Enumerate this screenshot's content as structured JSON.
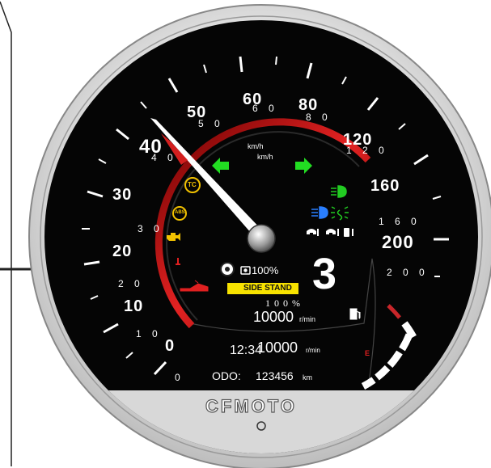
{
  "brand": {
    "name": "CFMOTO"
  },
  "speedometer": {
    "unit": "km/h",
    "major_scale": [
      "0",
      "10",
      "20",
      "30",
      "40",
      "50",
      "60",
      "80",
      "120",
      "160",
      "200"
    ],
    "minor_scale": [
      "1 0",
      "2 0",
      "3 0",
      "4 0",
      "5 0",
      "6 0",
      "8 0",
      "1 2 0",
      "1 6 0",
      "2 0 0"
    ],
    "needle_value_kmh": 40
  },
  "display": {
    "unit_label_1": "km/h",
    "unit_label_2": "km/h",
    "camera_percent": "100%",
    "gear": "3",
    "side_stand_label": "SIDE STAND",
    "rpm_percent": "1 0 0 %",
    "rpm_value": "10000",
    "rpm_unit": "r/min",
    "clock": "12:34",
    "clock_rpm_overlay": "10000",
    "clock_rpm_unit": "r/min",
    "odometer_label": "ODO:",
    "odometer_value": "123456",
    "odometer_unit": "km"
  },
  "indicators": {
    "traction_control": "TC",
    "abs": "ABS",
    "turn_signal_color": "#22dd22",
    "warning_color": "#f2c200",
    "danger_color": "#e02020",
    "high_beam_color": "#2a7fff",
    "low_beam_color": "#22cc22"
  },
  "fuel_gauge": {
    "label_empty": "E",
    "level_fraction": 0.55
  },
  "colors": {
    "arc_red": "#d41f1f",
    "face": "#050505",
    "bezel": "#d8d8d8",
    "needle": "#ffffff"
  }
}
